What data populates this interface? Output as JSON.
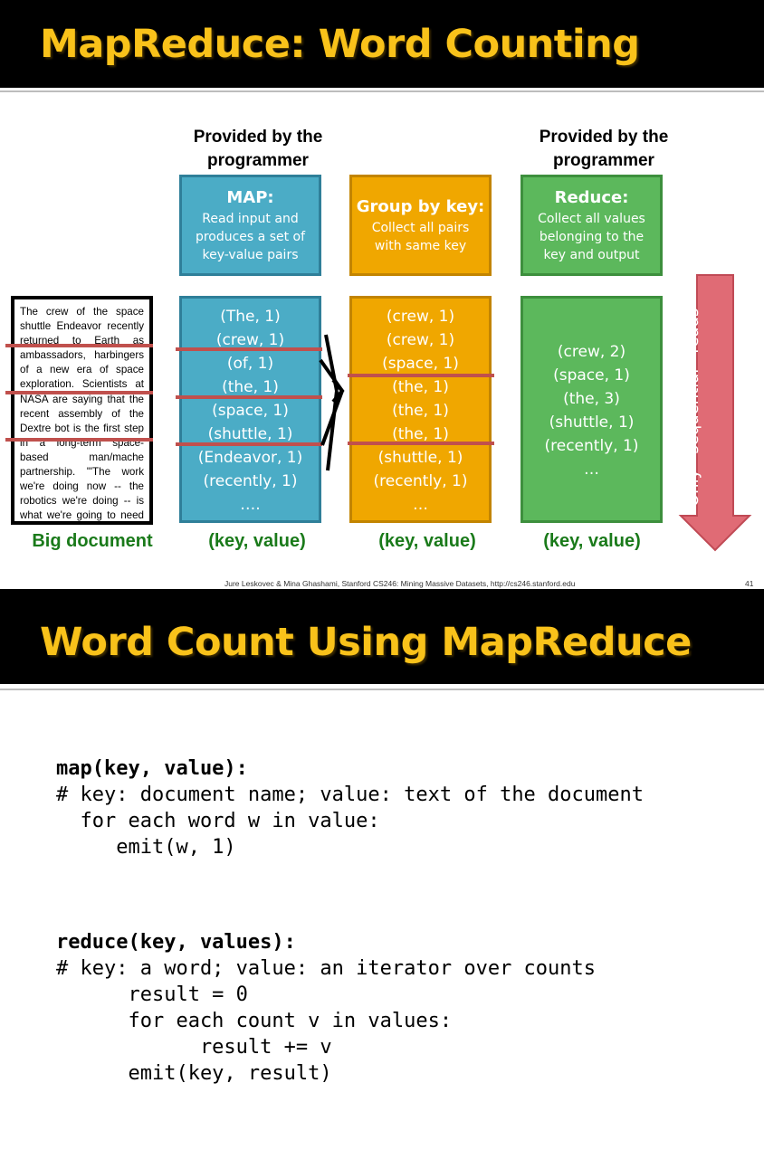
{
  "slide1": {
    "title": "MapReduce: Word Counting",
    "headings": {
      "left": "Provided by the programmer",
      "right": "Provided by the programmer"
    },
    "map": {
      "title": "MAP:",
      "desc": "Read input and produces a set of key-value pairs"
    },
    "group": {
      "title": "Group by key:",
      "desc": "Collect all pairs with same key"
    },
    "reduce": {
      "title": "Reduce:",
      "desc": "Collect all values belonging to the key and output"
    },
    "document_text": "The crew of the space shuttle Endeavor recently returned to Earth as ambassadors, harbingers of a new era of space exploration. Scientists at NASA are saying that the recent assembly of the Dextre bot is the first step in a long-term space-based man/mache partnership. '\"The work we're doing now -- the robotics we're doing -- is what we're going to need ……………………..",
    "map_pairs": [
      "(The, 1)",
      "(crew, 1)",
      "(of, 1)",
      "(the, 1)",
      "(space, 1)",
      "(shuttle, 1)",
      "(Endeavor, 1)",
      "(recently, 1)",
      "…."
    ],
    "group_pairs": [
      "(crew, 1)",
      "(crew, 1)",
      "(space, 1)",
      "(the, 1)",
      "(the, 1)",
      "(the, 1)",
      "(shuttle, 1)",
      "(recently, 1)",
      "…"
    ],
    "reduce_pairs": [
      "(crew, 2)",
      "(space, 1)",
      "(the, 3)",
      "(shuttle, 1)",
      "(recently, 1)",
      "…"
    ],
    "captions": {
      "doc": "Big document",
      "map": "(key, value)",
      "group": "(key, value)",
      "reduce": "(key, value)"
    },
    "arrow_label": "Only   sequential   reads",
    "footer": "Jure Leskovec & Mina Ghashami, Stanford CS246: Mining Massive Datasets, http://cs246.stanford.edu",
    "page_number": "41",
    "colors": {
      "title": "#f9c21a",
      "map": "#4bacc6",
      "group": "#f0a700",
      "reduce": "#5cb85c",
      "arrow": "#e06b75",
      "caption": "#1a7a1a"
    }
  },
  "slide2": {
    "title": "Word Count Using MapReduce",
    "map_signature": "map(key, value):",
    "map_lines": [
      "# key: document name; value: text of the document",
      "  for each word w in value:",
      "     emit(w, 1)"
    ],
    "reduce_signature": "reduce(key, values):",
    "reduce_lines": [
      "# key: a word; value: an iterator over counts",
      "      result = 0",
      "      for each count v in values:",
      "            result += v",
      "      emit(key, result)"
    ]
  }
}
